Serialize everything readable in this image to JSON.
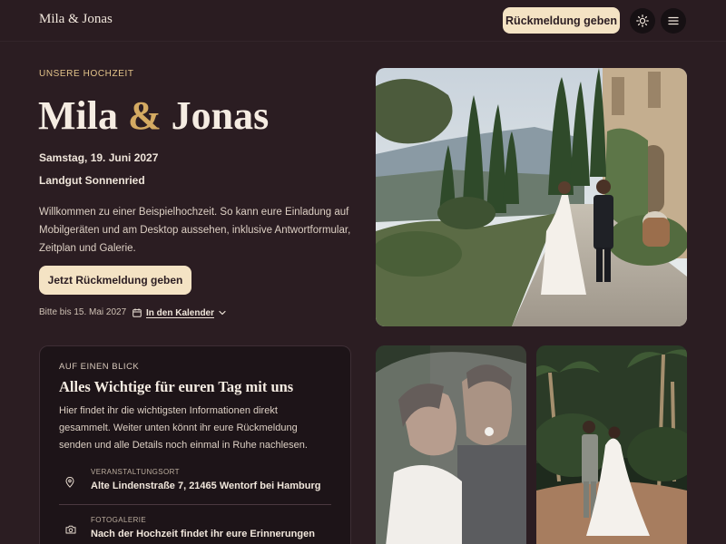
{
  "header": {
    "brand": "Mila & Jonas",
    "rsvp_label": "Rückmeldung geben",
    "theme_icon": "sun-icon",
    "menu_icon": "menu-icon"
  },
  "hero": {
    "eyebrow": "UNSERE HOCHZEIT",
    "title_first": "Mila",
    "title_amp": "&",
    "title_second": "Jonas",
    "date": "Samstag, 19. Juni 2027",
    "venue": "Landgut Sonnenried",
    "intro": "Willkommen zu einer Beispielhochzeit. So kann eure Einladung auf Mobilgeräten und am Desktop aussehen, inklusive Antwortformular, Zeitplan und Galerie.",
    "rsvp_label": "Jetzt Rückmeldung geben",
    "deadline": "Bitte bis 15. Mai 2027",
    "calendar_label": "In den Kalender"
  },
  "card": {
    "eyebrow": "AUF EINEN BLICK",
    "title": "Alles Wichtige für euren Tag mit uns",
    "text": "Hier findet ihr die wichtigsten Informationen direkt gesammelt. Weiter unten könnt ihr eure Rückmeldung senden und alle Details noch einmal in Ruhe nachlesen.",
    "items": [
      {
        "icon": "location-pin-icon",
        "label": "VERANSTALTUNGSORT",
        "value": "Alte Lindenstraße 7, 21465 Wentorf bei Hamburg"
      },
      {
        "icon": "camera-icon",
        "label": "FOTOGALERIE",
        "value": "Nach der Hochzeit findet ihr eure Erinnerungen"
      }
    ]
  },
  "colors": {
    "background": "#2b1d22",
    "accent": "#f4e3c4",
    "gold": "#d4aa62",
    "card": "#1d1418"
  }
}
